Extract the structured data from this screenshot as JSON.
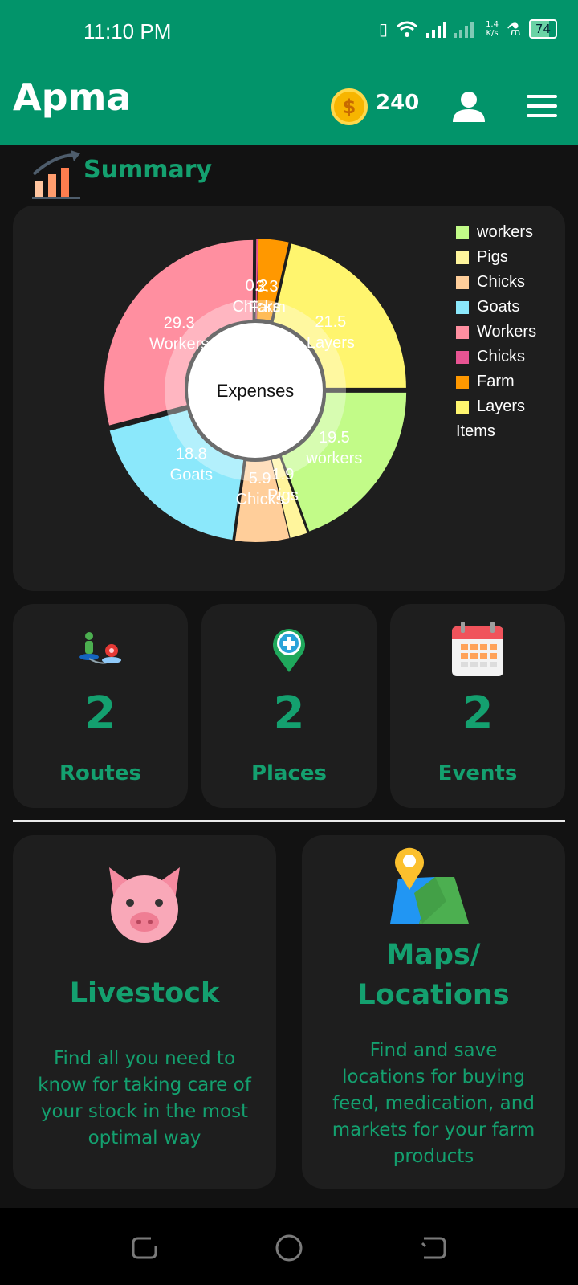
{
  "status": {
    "time": "11:10 PM",
    "net_speed_value": "1.4",
    "net_speed_unit": "K/s",
    "battery": "74"
  },
  "header": {
    "app_name": "Apma",
    "coin_symbol": "$",
    "coins": "240"
  },
  "summary": {
    "title": "Summary"
  },
  "chart_data": {
    "type": "pie",
    "center_label": "Expenses",
    "legend_title": "Items",
    "outer": [
      {
        "label": "workers",
        "value": 19.5,
        "color": "#c2fb88"
      },
      {
        "label": "Pigs",
        "value": 1.9,
        "color": "#fff59c"
      },
      {
        "label": "Chicks",
        "value": 5.9,
        "color": "#ffce9a"
      },
      {
        "label": "Goats",
        "value": 18.8,
        "color": "#8be8fb"
      },
      {
        "label": "Workers",
        "value": 29.3,
        "color": "#ff8fa0"
      },
      {
        "label": "Chicks",
        "value": 0.2,
        "color": "#e85493"
      },
      {
        "label": "Farm",
        "value": 3.3,
        "color": "#ff9800"
      },
      {
        "label": "Layers",
        "value": 21.5,
        "color": "#fff56e"
      }
    ]
  },
  "stats": [
    {
      "value": "2",
      "label": "Routes",
      "icon": "route-icon"
    },
    {
      "value": "2",
      "label": "Places",
      "icon": "add-place-icon"
    },
    {
      "value": "2",
      "label": "Events",
      "icon": "calendar-icon"
    }
  ],
  "features": [
    {
      "title_lines": [
        "Livestock"
      ],
      "desc_lines": [
        "Find all you need to",
        "know for taking care of",
        "your stock in the most",
        "optimal way"
      ],
      "icon": "pig-icon"
    },
    {
      "title_lines": [
        "Maps/",
        "Locations"
      ],
      "desc_lines": [
        "Find and save",
        "locations for buying",
        "feed, medication, and",
        "markets for your farm",
        "products"
      ],
      "icon": "map-icon"
    }
  ]
}
